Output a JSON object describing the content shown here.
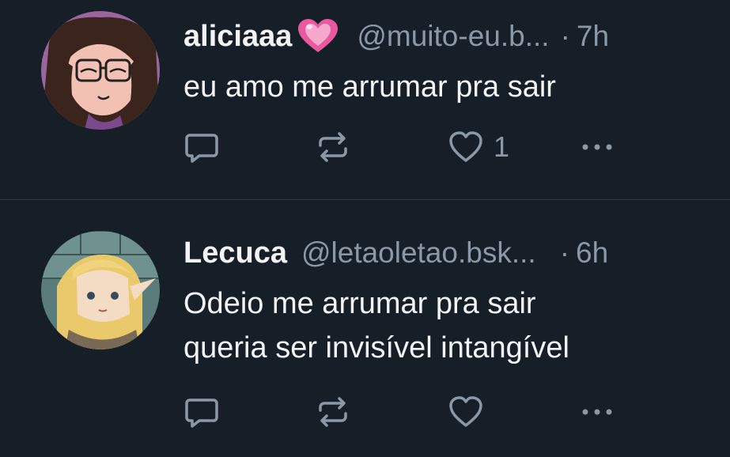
{
  "posts": [
    {
      "display_name": "aliciaaa",
      "emoji": "pink-heart",
      "handle": "@muito-eu.b...",
      "separator": "·",
      "time": "7h",
      "text_lines": [
        "eu amo me arrumar pra sair"
      ],
      "likes": "1"
    },
    {
      "display_name": "Lecuca",
      "handle": "@letaoletao.bsk...",
      "separator": "·",
      "time": "6h",
      "text_lines": [
        "Odeio me arrumar pra sair",
        "queria ser invisível intangível"
      ],
      "likes": ""
    }
  ],
  "colors": {
    "background": "#161e27",
    "text": "#f1f3f5",
    "muted": "#8b98a5",
    "divider": "#2e3945",
    "heart": "#e85aa0"
  },
  "icons": {
    "reply": "comment-icon",
    "repost": "repost-icon",
    "like": "heart-icon",
    "more": "more-icon"
  }
}
